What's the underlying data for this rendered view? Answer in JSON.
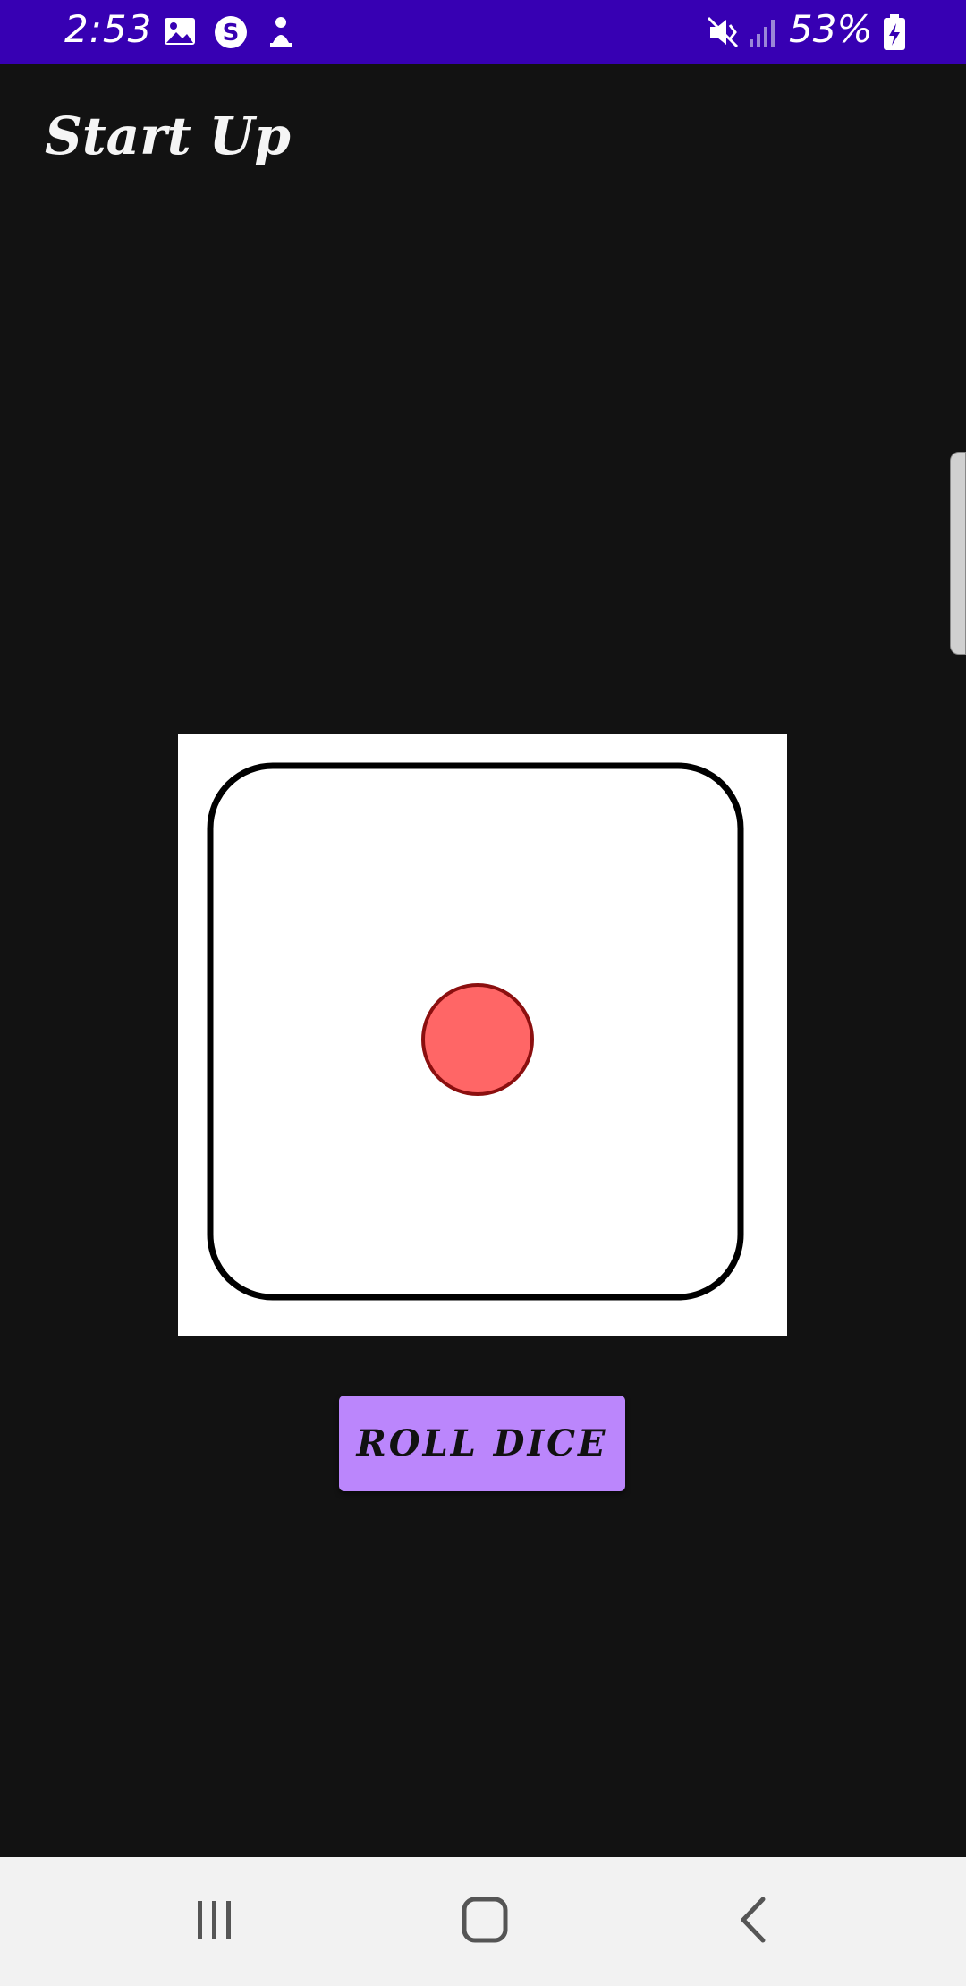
{
  "status_bar": {
    "time": "2:53",
    "battery_percent": "53%",
    "background_color": "#3700b3",
    "left_icons": [
      "image-icon",
      "s-circle-icon",
      "notification-icon"
    ],
    "right_icons": [
      "mute-vibrate-icon",
      "signal-icon",
      "battery-charging-icon"
    ]
  },
  "header": {
    "title": "Start Up"
  },
  "dice": {
    "face_value": 1,
    "pip_color": "#ff6666"
  },
  "actions": {
    "roll_label": "ROLL DICE",
    "button_color": "#bb86fc"
  },
  "nav_bar": {
    "buttons": [
      "recent-apps-icon",
      "home-icon",
      "back-icon"
    ]
  }
}
